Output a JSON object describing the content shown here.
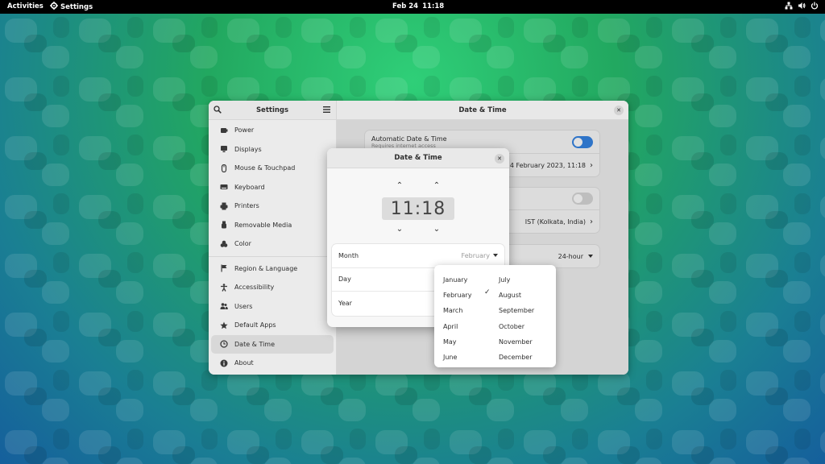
{
  "topbar": {
    "activities": "Activities",
    "app_name": "Settings",
    "date": "Feb 24",
    "time": "11:18"
  },
  "window": {
    "sidebar_title": "Settings",
    "content_title": "Date & Time",
    "nav_items": [
      {
        "label": "Power",
        "icon": "power-icon"
      },
      {
        "label": "Displays",
        "icon": "display-icon"
      },
      {
        "label": "Mouse & Touchpad",
        "icon": "mouse-icon"
      },
      {
        "label": "Keyboard",
        "icon": "keyboard-icon"
      },
      {
        "label": "Printers",
        "icon": "printer-icon"
      },
      {
        "label": "Removable Media",
        "icon": "usb-icon"
      },
      {
        "label": "Color",
        "icon": "color-icon"
      },
      {
        "label": "Region & Language",
        "icon": "flag-icon"
      },
      {
        "label": "Accessibility",
        "icon": "accessibility-icon"
      },
      {
        "label": "Users",
        "icon": "users-icon"
      },
      {
        "label": "Default Apps",
        "icon": "star-icon"
      },
      {
        "label": "Date & Time",
        "icon": "clock-icon"
      },
      {
        "label": "About",
        "icon": "info-icon"
      }
    ],
    "selected_item": "Date & Time",
    "auto_datetime_label": "Automatic Date & Time",
    "auto_datetime_sub": "Requires internet access",
    "datetime_value": "24 February 2023, 11:18",
    "timezone_value": "IST (Kolkata, India)",
    "time_format_value": "24-hour"
  },
  "dialog": {
    "title": "Date & Time",
    "hour": "11",
    "minute": "18",
    "month_label": "Month",
    "month_value": "February",
    "day_label": "Day",
    "year_label": "Year"
  },
  "month_popover": {
    "left": [
      "January",
      "February",
      "March",
      "April",
      "May",
      "June"
    ],
    "right": [
      "July",
      "August",
      "September",
      "October",
      "November",
      "December"
    ],
    "checked": "February"
  },
  "colors": {
    "accent": "#3584e4",
    "wallpaper_green": "#2fcf78",
    "wallpaper_blue": "#155f9c"
  }
}
